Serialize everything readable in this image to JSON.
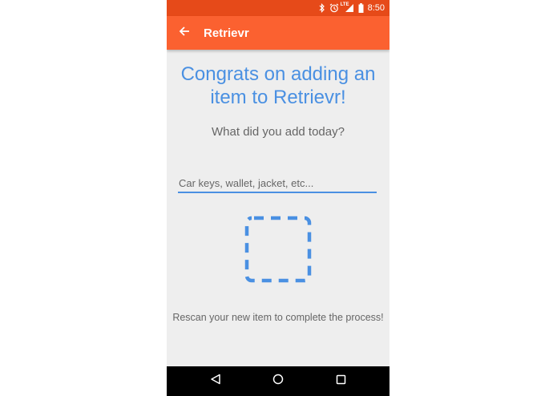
{
  "status_bar": {
    "time": "8:50",
    "network_label": "LTE",
    "icons": [
      "bluetooth-icon",
      "alarm-icon",
      "signal-icon",
      "battery-icon"
    ]
  },
  "app_bar": {
    "title": "Retrievr",
    "back_icon": "arrow-back-icon"
  },
  "main": {
    "headline": "Congrats on adding an item to Retrievr!",
    "question": "What did you add today?",
    "item_input": {
      "placeholder": "Car keys, wallet, jacket, etc...",
      "value": ""
    },
    "scan_icon": "scan-frame-icon",
    "rescan_text": "Rescan your new item to complete the process!"
  },
  "nav_bar": {
    "items": [
      "back-triangle-icon",
      "home-circle-icon",
      "recents-square-icon"
    ]
  },
  "colors": {
    "status_bar": "#e64a19",
    "app_bar": "#fb6130",
    "accent": "#4a90e2",
    "background": "#eeeeee"
  }
}
